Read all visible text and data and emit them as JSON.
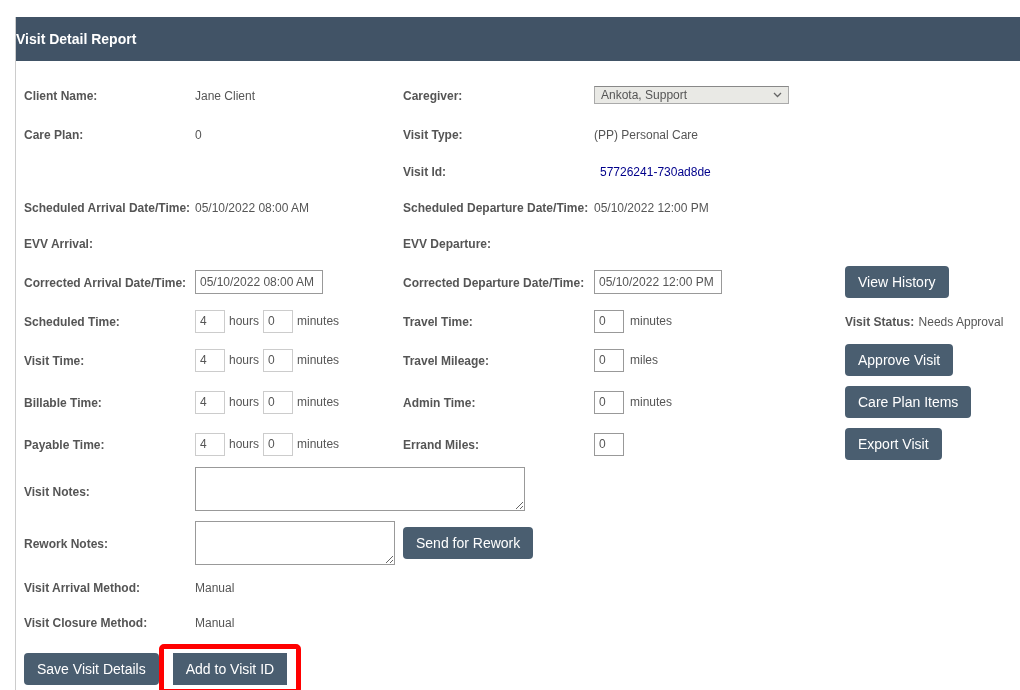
{
  "header": {
    "title": "Visit Detail Report"
  },
  "rows": [
    {
      "left": {
        "label": "Client Name:",
        "kind": "text",
        "value": "Jane Client"
      },
      "right": {
        "label": "Caregiver:",
        "kind": "select",
        "value": "Ankota, Support"
      }
    },
    {
      "left": {
        "label": "Care Plan:",
        "kind": "text",
        "value": "0"
      },
      "right": {
        "label": "Visit Type:",
        "kind": "text",
        "value": "(PP) Personal Care"
      }
    },
    {
      "right": {
        "label": "Visit Id:",
        "kind": "link",
        "value": "57726241-730ad8de"
      }
    },
    {
      "left": {
        "label": "Scheduled Arrival Date/Time:",
        "kind": "text",
        "value": "05/10/2022 08:00 AM"
      },
      "right": {
        "label": "Scheduled Departure Date/Time:",
        "kind": "text",
        "value": "05/10/2022 12:00 PM"
      }
    },
    {
      "left": {
        "label": "EVV Arrival:",
        "kind": "empty"
      },
      "right": {
        "label": "EVV Departure:",
        "kind": "empty"
      }
    },
    {
      "left": {
        "label": "Corrected Arrival Date/Time:",
        "kind": "datetime",
        "value": "05/10/2022 08:00 AM"
      },
      "right": {
        "label": "Corrected Departure Date/Time:",
        "kind": "datetime",
        "value": "05/10/2022 12:00 PM"
      },
      "side": {
        "kind": "button",
        "label": "View History"
      }
    },
    {
      "left": {
        "label": "Scheduled Time:",
        "kind": "duration",
        "hours": "4",
        "hours_unit": "hours",
        "minutes": "0",
        "minutes_unit": "minutes"
      },
      "right": {
        "label": "Travel Time:",
        "kind": "number",
        "value": "0",
        "unit": "minutes"
      },
      "side": {
        "kind": "status",
        "label": "Visit Status:",
        "value": "Needs Approval"
      }
    },
    {
      "left": {
        "label": "Visit Time:",
        "kind": "duration",
        "hours": "4",
        "hours_unit": "hours",
        "minutes": "0",
        "minutes_unit": "minutes"
      },
      "right": {
        "label": "Travel Mileage:",
        "kind": "number",
        "value": "0",
        "unit": "miles"
      },
      "side": {
        "kind": "button",
        "label": "Approve Visit"
      }
    },
    {
      "left": {
        "label": "Billable Time:",
        "kind": "duration",
        "hours": "4",
        "hours_unit": "hours",
        "minutes": "0",
        "minutes_unit": "minutes"
      },
      "right": {
        "label": "Admin Time:",
        "kind": "number",
        "value": "0",
        "unit": "minutes"
      },
      "side": {
        "kind": "button",
        "label": "Care Plan Items"
      }
    },
    {
      "left": {
        "label": "Payable Time:",
        "kind": "duration",
        "hours": "4",
        "hours_unit": "hours",
        "minutes": "0",
        "minutes_unit": "minutes"
      },
      "right": {
        "label": "Errand Miles:",
        "kind": "number",
        "value": "0"
      },
      "side": {
        "kind": "button",
        "label": "Export Visit"
      }
    },
    {
      "left": {
        "label": "Visit Notes:",
        "kind": "notes"
      }
    },
    {
      "left": {
        "label": "Rework Notes:",
        "kind": "rework",
        "button": "Send for Rework"
      }
    },
    {
      "left": {
        "label": "Visit Arrival Method:",
        "kind": "text",
        "value": "Manual"
      }
    },
    {
      "left": {
        "label": "Visit Closure Method:",
        "kind": "text",
        "value": "Manual"
      }
    }
  ],
  "actions": [
    {
      "label": "Save Visit Details",
      "highlighted": false
    },
    {
      "label": "Add to Visit ID",
      "highlighted": true
    }
  ]
}
